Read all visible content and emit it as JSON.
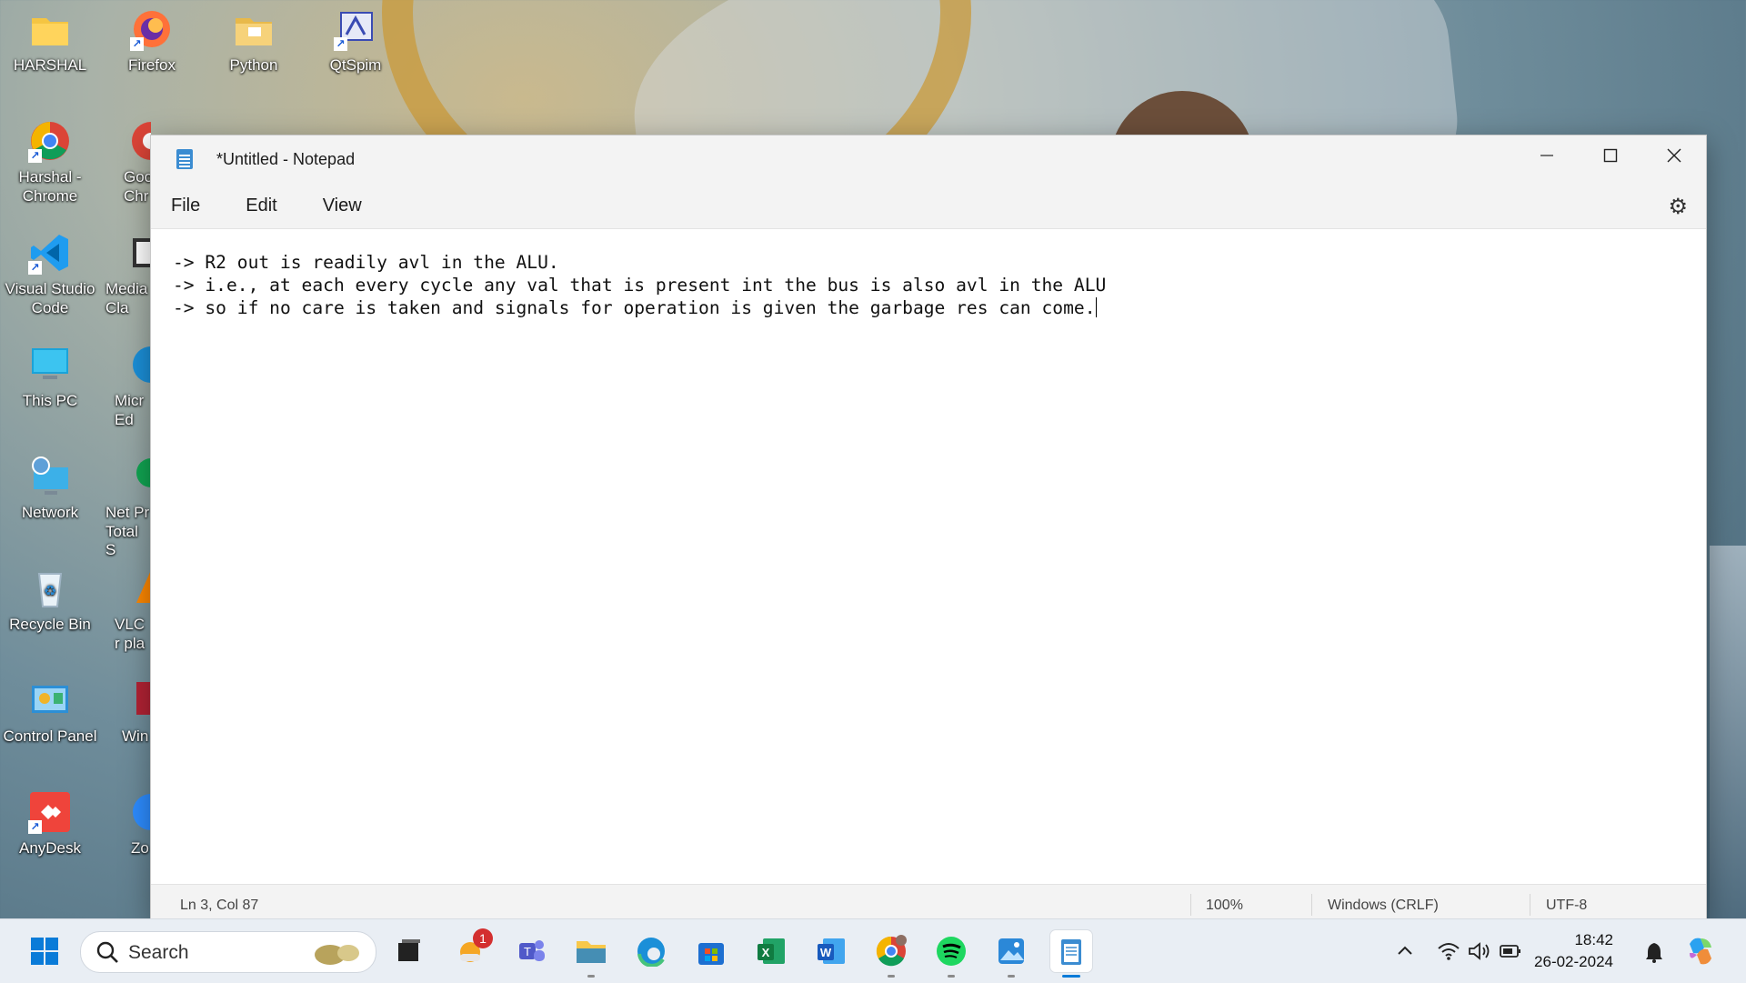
{
  "desktop": {
    "icons": [
      {
        "label": "HARSHAL",
        "icon": "folder-icon"
      },
      {
        "label": "Firefox",
        "icon": "firefox-icon"
      },
      {
        "label": "Python",
        "icon": "folder-icon"
      },
      {
        "label": "QtSpim",
        "icon": "qtspim-icon"
      },
      {
        "label": "Harshal - Chrome",
        "icon": "chrome-icon"
      },
      {
        "label": "Goo Chr",
        "icon": "chrome-icon"
      },
      {
        "label": "Visual Studio Code",
        "icon": "vscode-icon"
      },
      {
        "label": "Media Cla",
        "icon": "media-player-icon"
      },
      {
        "label": "This PC",
        "icon": "monitor-icon"
      },
      {
        "label": "Micr Ed",
        "icon": "edge-icon"
      },
      {
        "label": "Network",
        "icon": "network-icon"
      },
      {
        "label": "Net Pr Total S",
        "icon": "app-icon"
      },
      {
        "label": "Recycle Bin",
        "icon": "recycle-bin-icon"
      },
      {
        "label": "VLC r pla",
        "icon": "vlc-icon"
      },
      {
        "label": "Control Panel",
        "icon": "control-panel-icon"
      },
      {
        "label": "Win",
        "icon": "app-icon"
      },
      {
        "label": "AnyDesk",
        "icon": "anydesk-icon"
      },
      {
        "label": "Zo",
        "icon": "zoom-icon"
      }
    ]
  },
  "notepad": {
    "title": "*Untitled - Notepad",
    "menu": {
      "file": "File",
      "edit": "Edit",
      "view": "View"
    },
    "content": "-> R2 out is readily avl in the ALU.\n-> i.e., at each every cycle any val that is present int the bus is also avl in the ALU\n-> so if no care is taken and signals for operation is given the garbage res can come.",
    "status": {
      "position": "Ln 3, Col 87",
      "zoom": "100%",
      "line_ending": "Windows (CRLF)",
      "encoding": "UTF-8"
    }
  },
  "taskbar": {
    "search_placeholder": "Search",
    "notification_badge": "1",
    "time": "18:42",
    "date": "26-02-2024"
  }
}
